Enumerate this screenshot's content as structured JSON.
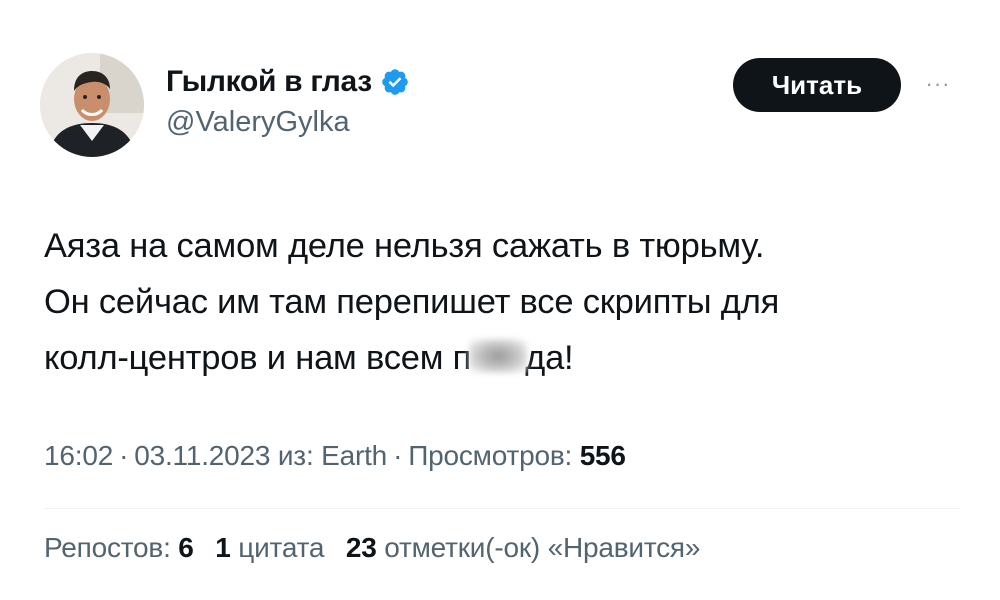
{
  "author": {
    "display_name": "Гылкой в глаз",
    "handle": "@ValeryGylka",
    "verified": true,
    "verified_icon": "verified-badge-icon",
    "verified_color": "#1d9bf0"
  },
  "follow_button": {
    "label": "Читать"
  },
  "more_button": {
    "icon": "more-horizontal-icon",
    "label": "···"
  },
  "tweet": {
    "line1": "Аяза на самом деле нельзя сажать в тюрьму.",
    "line2": "Он сейчас им там перепишет все скрипты для",
    "line3_before": "колл-центров и нам всем п",
    "line3_after": "да!"
  },
  "meta": {
    "time": "16:02",
    "date": "03.11.2023",
    "source_prefix": "из:",
    "source": "Earth",
    "views_label": "Просмотров:",
    "views_count": "556",
    "separator": "·"
  },
  "stats": {
    "reposts_label": "Репостов:",
    "reposts_count": "6",
    "quotes_count": "1",
    "quotes_label": "цитата",
    "likes_count": "23",
    "likes_label": "отметки(-ок) «Нравится»"
  },
  "colors": {
    "text_primary": "#0f1419",
    "text_secondary": "#536471",
    "button_bg": "#0f1419",
    "accent": "#1d9bf0"
  }
}
